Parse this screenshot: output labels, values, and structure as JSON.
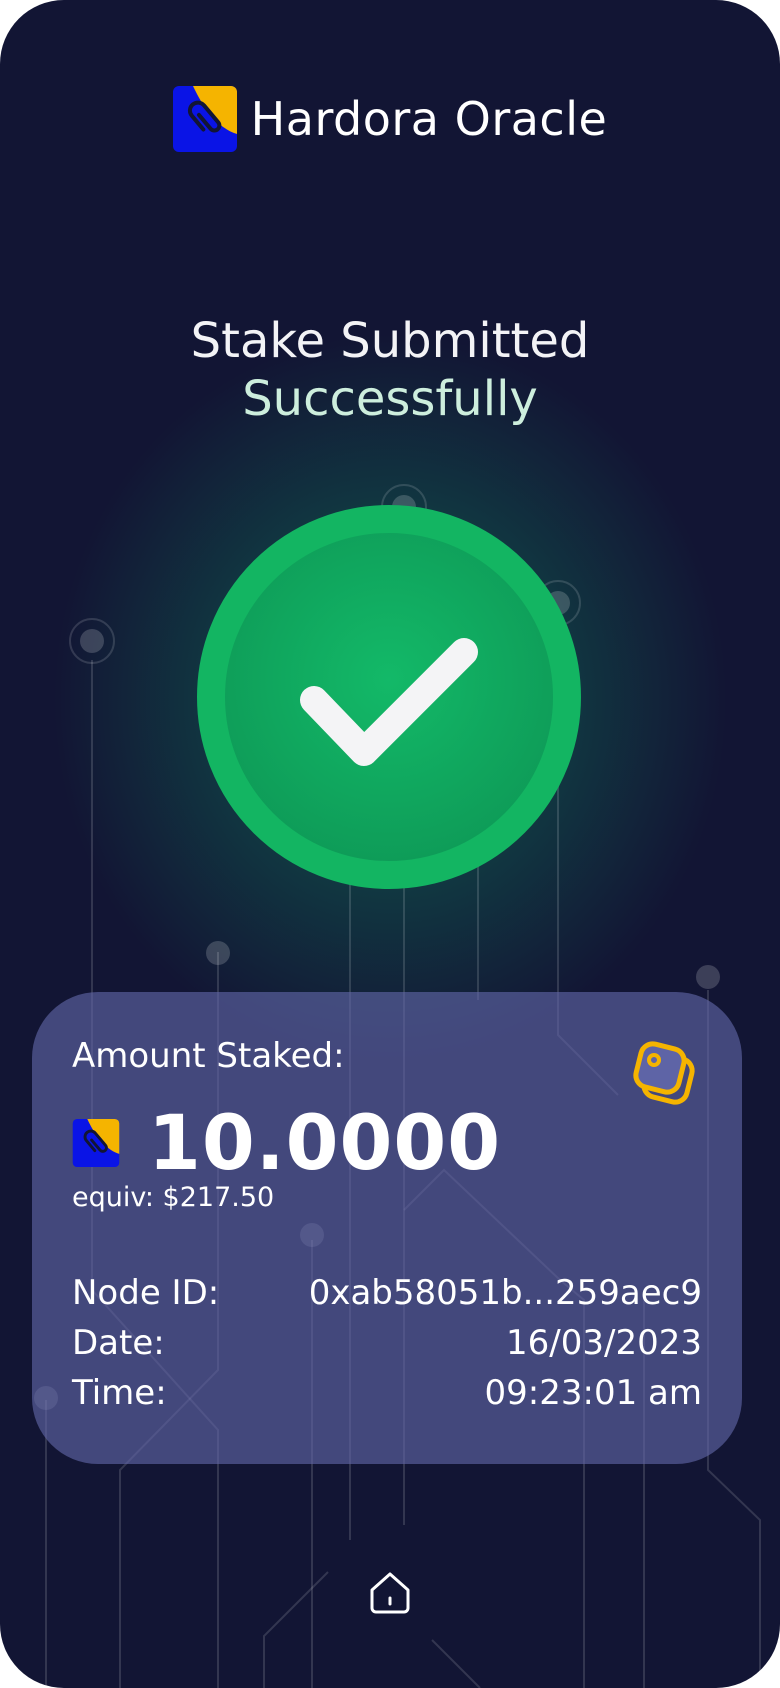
{
  "app": {
    "title": "Hardora Oracle"
  },
  "headline": {
    "line1": "Stake Submitted",
    "line2": "Successfully"
  },
  "card": {
    "amount_label": "Amount Staked:",
    "amount": "10.0000",
    "equiv": "equiv: $217.50",
    "details": [
      {
        "key": "Node ID:",
        "value": "0xab58051b...259aec9"
      },
      {
        "key": "Date:",
        "value": "16/03/2023"
      },
      {
        "key": "Time:",
        "value": "09:23:01 am"
      }
    ]
  },
  "icons": {
    "logo": "hardora-logo-icon",
    "success": "check-circle-icon",
    "stake": "stack-icon",
    "home": "home-icon"
  },
  "colors": {
    "background": "#121534",
    "success_green": "#12b562",
    "logo_blue": "#0a14e6",
    "logo_yellow": "#f5b400",
    "accent_yellow": "#f5b400",
    "card": "#5e64a6"
  }
}
